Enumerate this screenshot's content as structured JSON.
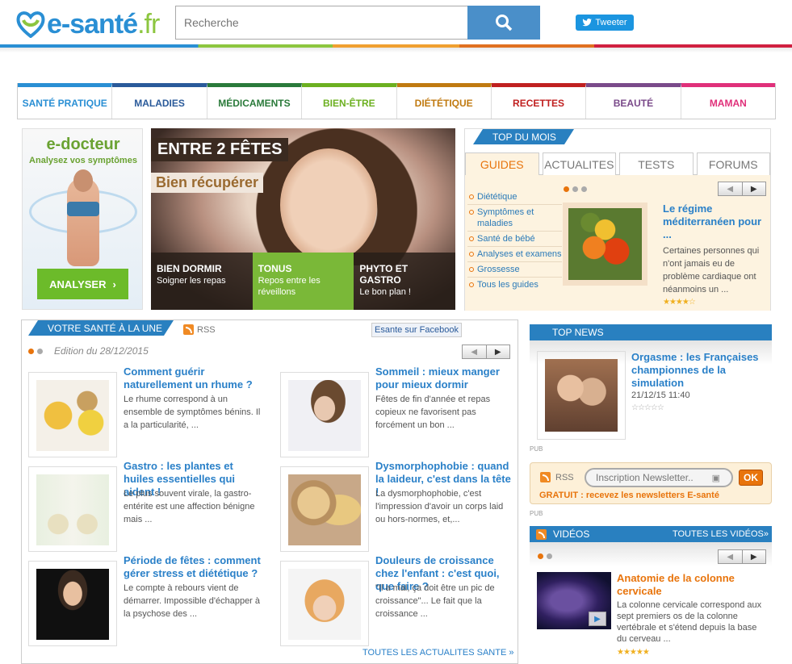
{
  "header": {
    "logo_main": "e-santé",
    "logo_tld": ".fr",
    "search_placeholder": "Recherche",
    "tweet_label": "Tweeter"
  },
  "nav": [
    {
      "label": "SANTÉ PRATIQUE",
      "color": "#2a8fd4"
    },
    {
      "label": "MALADIES",
      "color": "#2a5a9a"
    },
    {
      "label": "MÉDICAMENTS",
      "color": "#2a7a3a"
    },
    {
      "label": "BIEN-ÊTRE",
      "color": "#6cb020"
    },
    {
      "label": "DIÉTÉTIQUE",
      "color": "#c07a10"
    },
    {
      "label": "RECETTES",
      "color": "#c02020"
    },
    {
      "label": "BEAUTÉ",
      "color": "#7a4a8a"
    },
    {
      "label": "MAMAN",
      "color": "#e0307a"
    }
  ],
  "edoc": {
    "title": "e-docteur",
    "subtitle": "Analysez vos symptômes",
    "button": "ANALYSER"
  },
  "hero": {
    "title": "ENTRE 2 FÊTES",
    "subtitle": "Bien récupérer",
    "tabs": [
      {
        "title": "BIEN DORMIR",
        "sub": "Soigner les repas"
      },
      {
        "title": "TONUS",
        "sub": "Repos entre les réveillons"
      },
      {
        "title": "PHYTO ET GASTRO",
        "sub": "Le bon plan !"
      }
    ]
  },
  "top_mois": {
    "label": "TOP DU MOIS",
    "tabs": [
      "GUIDES",
      "ACTUALITES",
      "TESTS",
      "FORUMS"
    ],
    "links": [
      "Diététique",
      "Symptômes et maladies",
      "Santé de bébé",
      "Analyses et examens",
      "Grossesse",
      "Tous les guides"
    ],
    "article": {
      "title": "Le régime méditerranéen pour ...",
      "desc": "Certaines personnes qui n'ont jamais eu de problème cardiaque ont néanmoins un ...",
      "stars": "★★★★☆"
    }
  },
  "une": {
    "label": "VOTRE SANTÉ À LA UNE",
    "rss": "RSS",
    "facebook": "Esante sur Facebook",
    "edition": "Edition du 28/12/2015",
    "all_link": "TOUTES LES ACTUALITES SANTE »",
    "articles": [
      {
        "title": "Comment guérir naturellement un rhume ?",
        "desc": "Le rhume correspond à un ensemble de symptômes bénins. Il a la particularité, ..."
      },
      {
        "title": "Sommeil : mieux manger pour mieux dormir",
        "desc": "Fêtes de fin d'année et repas copieux ne favorisent pas forcément un bon ..."
      },
      {
        "title": "Gastro : les plantes et huiles essentielles qui aident !",
        "desc": "Le plus souvent virale, la gastro-entérite est une affection bénigne mais ..."
      },
      {
        "title": "Dysmorphophobie : quand la laideur, c'est dans la tête !",
        "desc": "La dysmorphophobie, c'est l'impression d'avoir un corps laid ou hors-normes, et,..."
      },
      {
        "title": "Période de fêtes : comment gérer stress et diététique ?",
        "desc": "Le compte à rebours vient de démarrer. Impossible d'échapper à la psychose des ..."
      },
      {
        "title": "Douleurs de croissance chez l'enfant : c'est quoi, que faire ?",
        "desc": "\"Il a mal, ça doit être un pic de croissance\"... Le fait que la croissance ..."
      }
    ]
  },
  "top_news": {
    "label": "TOP NEWS",
    "title": "Orgasme : les Françaises championnes de la simulation",
    "date": "21/12/15 11:40",
    "stars": "☆☆☆☆☆"
  },
  "pub": "PUB",
  "newsletter": {
    "rss": "RSS",
    "placeholder": "Inscription Newsletter..",
    "ok": "OK",
    "promo": "GRATUIT : recevez les newsletters E-santé"
  },
  "videos": {
    "label": "VIDÉOS",
    "all": "TOUTES LES VIDÉOS»",
    "title": "Anatomie de la colonne cervicale",
    "desc": "La colonne cervicale correspond aux sept premiers os de la colonne vertébrale et s'étend depuis la base du cerveau ...",
    "stars": "★★★★★"
  }
}
